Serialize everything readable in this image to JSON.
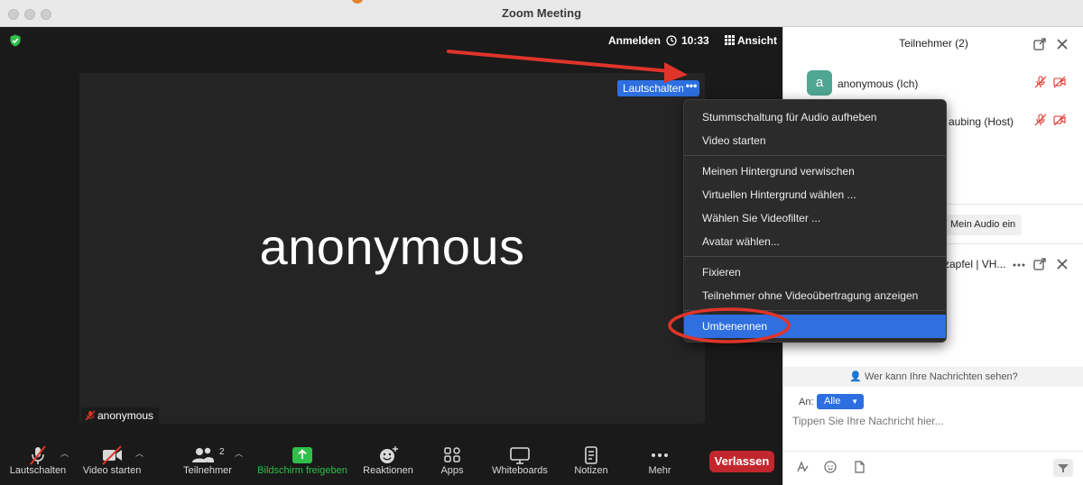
{
  "window": {
    "title": "Zoom Meeting"
  },
  "meeting": {
    "top_bar": {
      "signin": "Anmelden",
      "time": "10:33",
      "view": "Ansicht"
    },
    "participant_display_name": "anonymous",
    "tile_mute_label": "Lautschalten",
    "name_tag": "anonymous"
  },
  "toolbar": {
    "mute": "Lautschalten",
    "video": "Video starten",
    "participants": "Teilnehmer",
    "participants_count": "2",
    "share": "Bildschirm freigeben",
    "reactions": "Reaktionen",
    "apps": "Apps",
    "whiteboards": "Whiteboards",
    "notes": "Notizen",
    "more": "Mehr",
    "leave": "Verlassen"
  },
  "context_menu": {
    "items": [
      "Stummschaltung für Audio aufheben",
      "Video starten",
      "Meinen Hintergrund verwischen",
      "Virtuellen Hintergrund wählen ...",
      "Wählen Sie Videofilter ...",
      "Avatar wählen...",
      "Fixieren",
      "Teilnehmer ohne Videoübertragung anzeigen",
      "Umbenennen"
    ],
    "selected": "Umbenennen"
  },
  "participants_panel": {
    "title": "Teilnehmer (2)",
    "participants": [
      {
        "name": "anonymous (Ich)",
        "avatar": "a"
      },
      {
        "name": "aubing (Host)"
      }
    ],
    "audio_button": "Mein Audio ein"
  },
  "chat_panel": {
    "title": "zapfel | VH...",
    "visibility_text": "Wer kann Ihre Nachrichten sehen?",
    "to_label": "An:",
    "to_value": "Alle",
    "placeholder": "Tippen Sie Ihre Nachricht hier..."
  },
  "colors": {
    "accent": "#2d6fe0",
    "leave": "#c2272d",
    "share_green": "#2fbf4a",
    "annotation_red": "#e0342a",
    "avatar": "#4fa692"
  }
}
